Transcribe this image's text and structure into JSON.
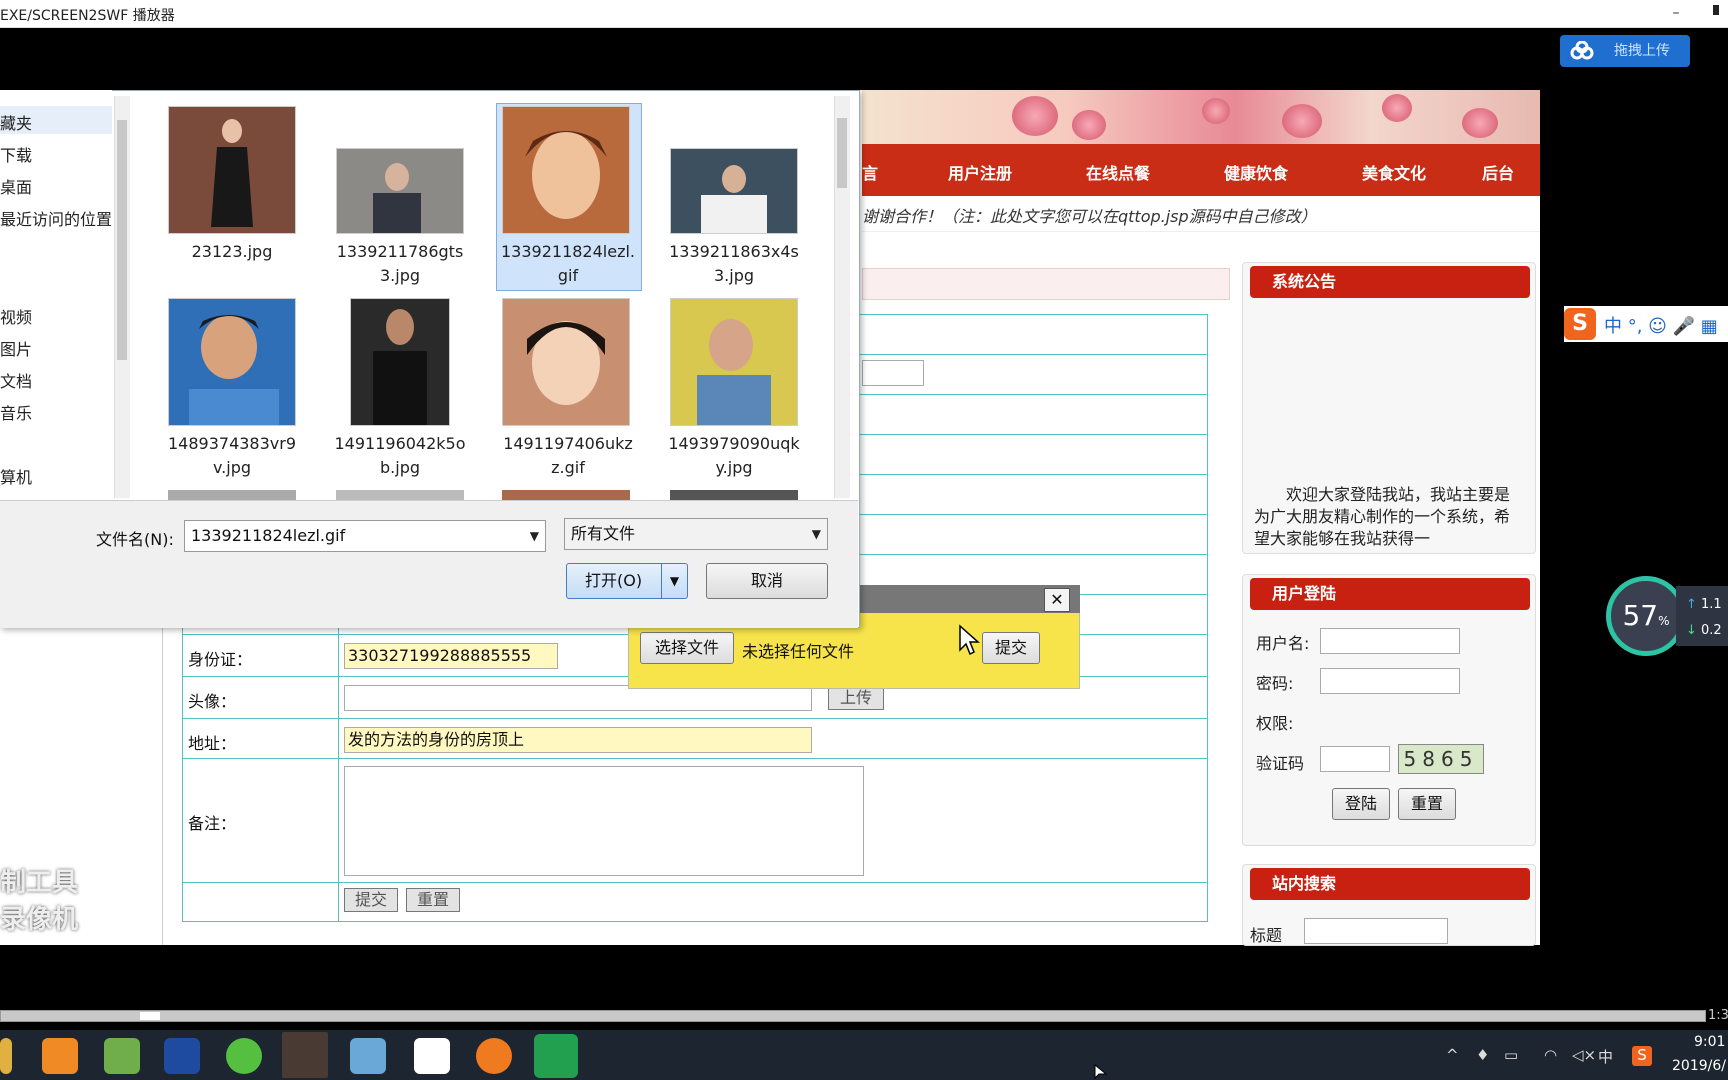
{
  "window": {
    "title": "EXE/SCREEN2SWF 播放器",
    "minimize": "–",
    "close": "⬛"
  },
  "upload_pill": {
    "label": "拖拽上传"
  },
  "site": {
    "nav_items": [
      "言",
      "用户注册",
      "在线点餐",
      "健康饮食",
      "美食文化",
      "后台"
    ],
    "marquee": "谢谢合作！（注：此处文字您可以在qttop.jsp源码中自己修改）",
    "announce_title": "系统公告",
    "announce_text": "欢迎大家登陆我站，我站主要是为广大朋友精心制作的一个系统，希望大家能够在我站获得一",
    "login_title": "用户登陆",
    "login_username": "用户名:",
    "login_password": "密码:",
    "login_role": "权限:",
    "login_captcha": "验证码",
    "captcha_code": "5865",
    "login_button": "登陆",
    "reset_button": "重置",
    "search_title": "站内搜索",
    "search_label": "标题"
  },
  "form": {
    "id_label": "身份证：",
    "id_value": "330327199288885555",
    "avatar_label": "头像：",
    "upload_button": "上传",
    "address_label": "地址：",
    "address_value": "发的方法的身份的房顶上",
    "remark_label": "备注：",
    "submit_button": "提交",
    "reset_button": "重置"
  },
  "popup": {
    "choose_file": "选择文件",
    "no_file": "未选择任何文件",
    "submit": "提交",
    "close": "✕"
  },
  "dialog": {
    "sidebar_items": [
      "藏夹",
      "下载",
      "桌面",
      "最近访问的位置",
      "视频",
      "图片",
      "文档",
      "音乐",
      "算机"
    ],
    "files": [
      {
        "name": "23123.jpg",
        "color": "#7a4a3a"
      },
      {
        "name": "1339211786gts3.jpg",
        "color": "#8b8a86"
      },
      {
        "name": "1339211824lezl.gif",
        "color": "#b86a3c"
      },
      {
        "name": "1339211863x4s3.jpg",
        "color": "#3d5060"
      },
      {
        "name": "1489374383vr9v.jpg",
        "color": "#2f6fb8"
      },
      {
        "name": "1491196042k5ob.jpg",
        "color": "#2a2a2a"
      },
      {
        "name": "1491197406ukzz.gif",
        "color": "#c89070"
      },
      {
        "name": "1493979090uqky.jpg",
        "color": "#d8c850"
      }
    ],
    "file_labels": [
      [
        "23123.jpg",
        ""
      ],
      [
        "1339211786gts",
        "3.jpg"
      ],
      [
        "1339211824lezl.",
        "gif"
      ],
      [
        "1339211863x4s",
        "3.jpg"
      ],
      [
        "1489374383vr9",
        "v.jpg"
      ],
      [
        "1491196042k5o",
        "b.jpg"
      ],
      [
        "1491197406ukz",
        "z.gif"
      ],
      [
        "1493979090uqk",
        "y.jpg"
      ]
    ],
    "filename_label": "文件名(N):",
    "filename_value": "1339211824lezl.gif",
    "filter_value": "所有文件",
    "open_button": "打开(O)",
    "cancel_button": "取消"
  },
  "overlays": {
    "watermark_line1": "制工具",
    "watermark_line2": "录像机",
    "speed_percent": "57",
    "speed_unit": "%",
    "speed_up": "1.1",
    "speed_down": "0.2",
    "ime": "中 °, ☺ 🎤 ▦"
  },
  "taskbar": {
    "time": "9:01",
    "date": "2019/6/",
    "ime_lang": "中",
    "player_time": "1:3"
  }
}
